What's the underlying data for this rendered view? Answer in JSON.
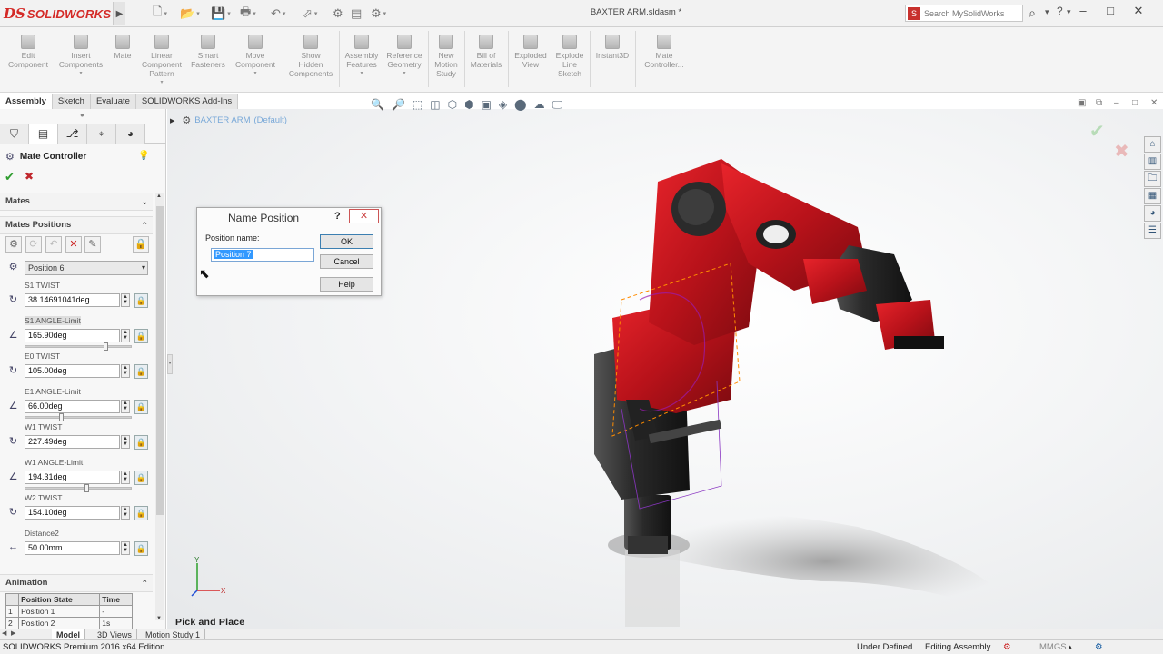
{
  "titlebar": {
    "logo_ds": "DS",
    "logo_text": "SOLIDWORKS",
    "document_title": "BAXTER ARM.sldasm *",
    "search_placeholder": "Search MySolidWorks",
    "help_label": "?",
    "minimize": "–",
    "restore": "□",
    "close": "✕"
  },
  "commands": [
    {
      "label": "Edit\nComponent"
    },
    {
      "label": "Insert\nComponents"
    },
    {
      "label": "Mate"
    },
    {
      "label": "Linear\nComponent\nPattern"
    },
    {
      "label": "Smart\nFasteners"
    },
    {
      "label": "Move\nComponent"
    },
    {
      "label": "Show\nHidden\nComponents"
    },
    {
      "label": "Assembly\nFeatures"
    },
    {
      "label": "Reference\nGeometry"
    },
    {
      "label": "New\nMotion\nStudy"
    },
    {
      "label": "Bill of\nMaterials"
    },
    {
      "label": "Exploded\nView"
    },
    {
      "label": "Explode\nLine\nSketch"
    },
    {
      "label": "Instant3D"
    },
    {
      "label": "Mate\nController..."
    }
  ],
  "tabs": [
    "Assembly",
    "Sketch",
    "Evaluate",
    "SOLIDWORKS Add-Ins"
  ],
  "property_manager": {
    "title": "Mate Controller",
    "ok": "✔",
    "cancel": "✖",
    "groups": {
      "mates": "Mates",
      "mates_positions": "Mates Positions",
      "animation": "Animation"
    },
    "position_select": "Position 6",
    "params": [
      {
        "label": "S1 TWIST",
        "value": "38.14691041deg",
        "highlight": false
      },
      {
        "label": "S1 ANGLE-Limit",
        "value": "165.90deg",
        "highlight": true
      },
      {
        "label": "E0 TWIST",
        "value": "105.00deg",
        "highlight": false
      },
      {
        "label": "E1 ANGLE-Limit",
        "value": "66.00deg",
        "highlight": false
      },
      {
        "label": "W1 TWIST",
        "value": "227.49deg",
        "highlight": false
      },
      {
        "label": "W1 ANGLE-Limit",
        "value": "194.31deg",
        "highlight": false
      },
      {
        "label": "W2 TWIST",
        "value": "154.10deg",
        "highlight": false
      },
      {
        "label": "Distance2",
        "value": "50.00mm",
        "highlight": false
      }
    ],
    "slider_levels": [
      0.77,
      0.33,
      0.58
    ],
    "animation_table": {
      "headers": [
        "Position State",
        "Time"
      ],
      "rows": [
        [
          "1",
          "Position 1",
          "-"
        ],
        [
          "2",
          "Position 2",
          "1s"
        ]
      ]
    }
  },
  "viewport": {
    "tree_root": "BAXTER ARM",
    "tree_config": "(Default)",
    "label": "Pick and Place",
    "triad_y": "Y",
    "triad_x": "X"
  },
  "dialog": {
    "title": "Name Position",
    "help": "?",
    "close": "✕",
    "field_label": "Position name:",
    "field_value": "Position 7",
    "ok": "OK",
    "cancel": "Cancel",
    "help_button": "Help"
  },
  "bottom_tabs": [
    "Model",
    "3D Views",
    "Motion Study 1"
  ],
  "status": {
    "edition": "SOLIDWORKS Premium 2016 x64 Edition",
    "state": "Under Defined",
    "mode": "Editing Assembly",
    "units": "MMGS"
  },
  "colors": {
    "brand_red": "#d42a27",
    "robot_red": "#c8141c",
    "selection_orange": "#ff8c00"
  }
}
